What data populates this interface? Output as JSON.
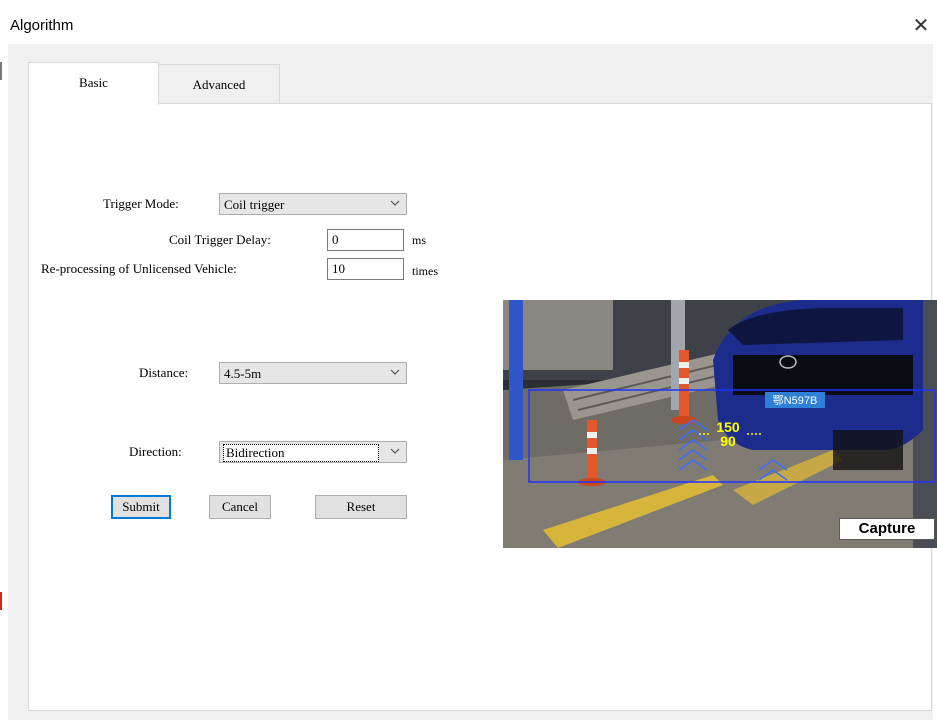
{
  "window": {
    "title": "Algorithm",
    "close_glyph": "✕"
  },
  "tabs": [
    {
      "label": "Basic",
      "active": true
    },
    {
      "label": "Advanced",
      "active": false
    }
  ],
  "form": {
    "trigger_mode": {
      "label": "Trigger Mode:",
      "value": "Coil trigger"
    },
    "coil_trigger_delay": {
      "label": "Coil Trigger Delay:",
      "value": "0",
      "unit": "ms"
    },
    "reprocessing": {
      "label": "Re-processing of Unlicensed Vehicle:",
      "value": "10",
      "unit": "times"
    },
    "distance": {
      "label": "Distance:",
      "value": "4.5-5m"
    },
    "direction": {
      "label": "Direction:",
      "value": "Bidirection"
    }
  },
  "buttons": {
    "submit": "Submit",
    "cancel": "Cancel",
    "reset": "Reset"
  },
  "preview": {
    "capture_label": "Capture",
    "plate_text": "鄂N597B",
    "overlay_top_value": "150",
    "overlay_bottom_value": "90",
    "overlay_color": "#ffff00",
    "detection_box_color": "#1f33ff"
  },
  "icons": {
    "close": "close-icon",
    "dropdown": "chevron-down-icon"
  }
}
